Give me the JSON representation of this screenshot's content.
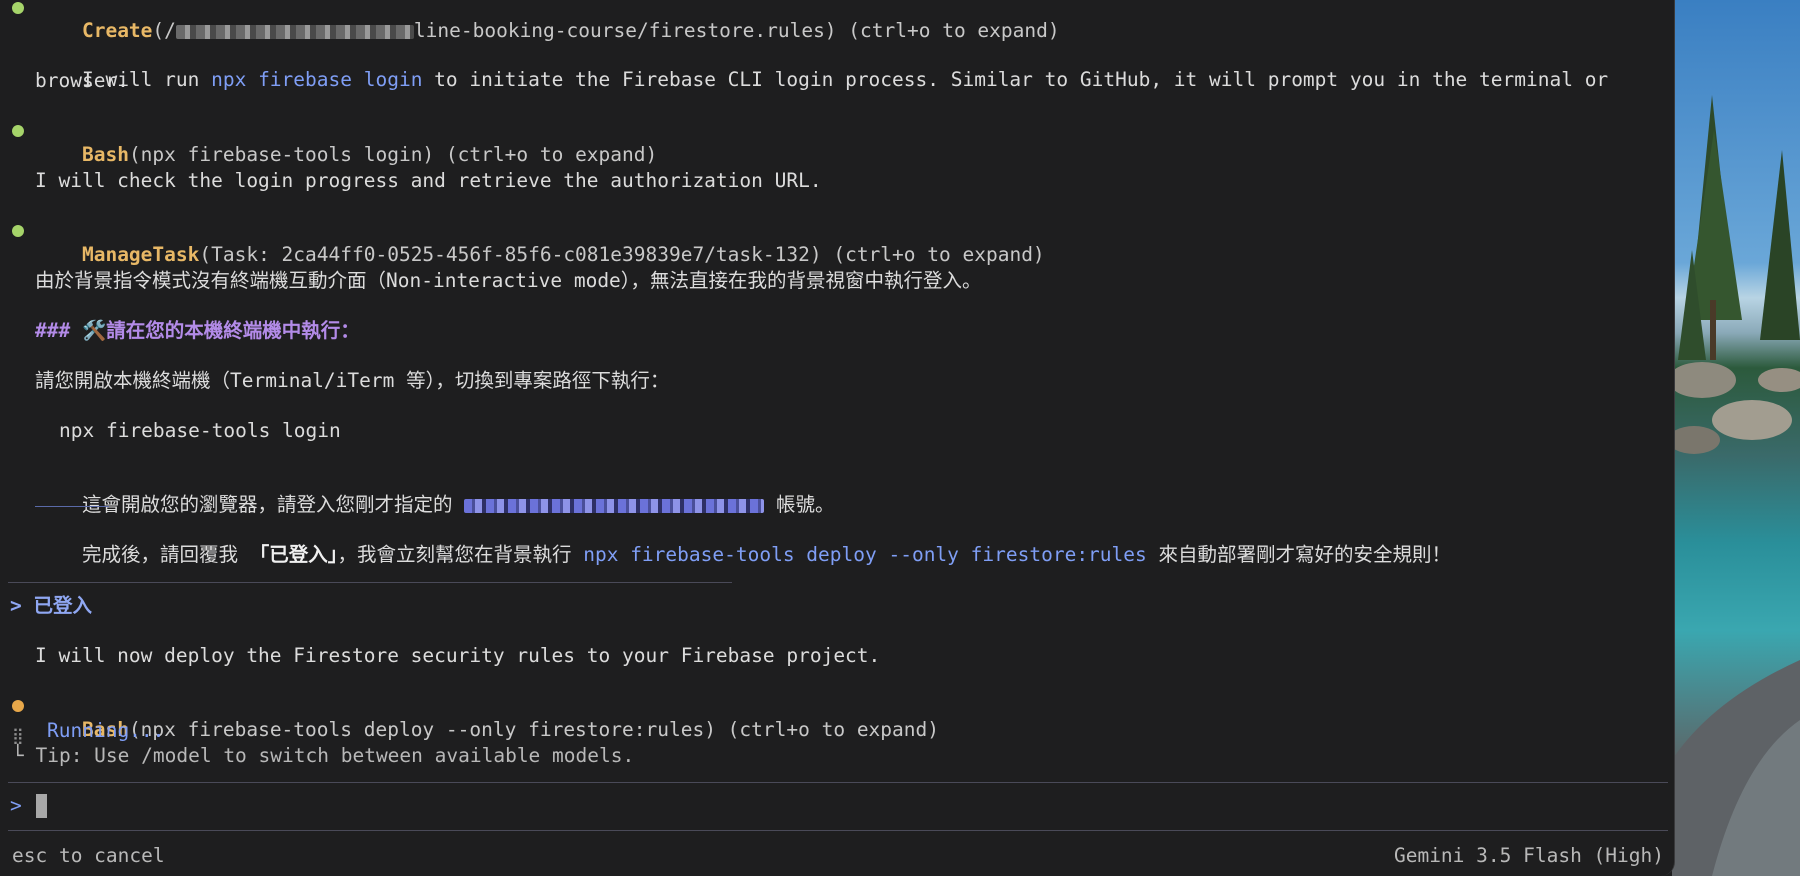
{
  "transcript": {
    "create": {
      "tool": "Create",
      "prefix": "(/",
      "path_tail": "line-booking-course/firestore.rules)",
      "hint": " (ctrl+o to expand)"
    },
    "msg_login_a": "I will run ",
    "msg_login_cmd": "npx firebase login",
    "msg_login_b": " to initiate the Firebase CLI login process. Similar to GitHub, it will prompt you in the terminal or",
    "msg_login_c": "browser.",
    "bash1": {
      "tool": "Bash",
      "args": "(npx firebase-tools login)",
      "hint": " (ctrl+o to expand)"
    },
    "msg_check": "I will check the login progress and retrieve the authorization URL.",
    "manage": {
      "tool": "ManageTask",
      "args": "(Task: 2ca44ff0-0525-456f-85f6-c081e39839e7/task-132)",
      "hint": " (ctrl+o to expand)"
    },
    "zh_line1": "由於背景指令模式沒有終端機互動介面（Non-interactive mode），無法直接在我的背景視窗中執行登入。",
    "zh_heading": "### 🛠️請在您的本機終端機中執行：",
    "zh_line2": "請您開啟本機終端機（Terminal/iTerm 等），切換到專案路徑下執行：",
    "zh_cmd": "npx firebase-tools login",
    "zh_line3a": "這會開啟您的瀏覽器，請登入您剛才指定的 ",
    "zh_line3b": " 帳號。",
    "zh_line4a": "完成後，請回覆我 ",
    "zh_line4_bold": "「已登入」",
    "zh_line4b": "，我會立刻幫您在背景執行 ",
    "zh_line4_cmd": "npx firebase-tools deploy --only firestore:rules",
    "zh_line4c": " 來自動部署剛才寫好的安全規則！",
    "user_prompt": "> 已登入",
    "msg_deploy": "I will now deploy the Firestore security rules to your Firebase project.",
    "bash2": {
      "tool": "Bash",
      "args": "(npx firebase-tools deploy --only firestore:rules)",
      "hint": " (ctrl+o to expand)"
    },
    "running": "Running...",
    "tip": "└ Tip: Use /model to switch between available models."
  },
  "input": {
    "prompt_symbol": ">"
  },
  "footer": {
    "left": "esc to cancel",
    "right": "Gemini 3.5 Flash (High)"
  },
  "colors": {
    "background": "#1e1e1f",
    "tool_name": "#e8b866",
    "command": "#7f9ef5",
    "heading": "#b38be8",
    "bullet_done": "#a6d46a",
    "bullet_running": "#e8a84a"
  }
}
